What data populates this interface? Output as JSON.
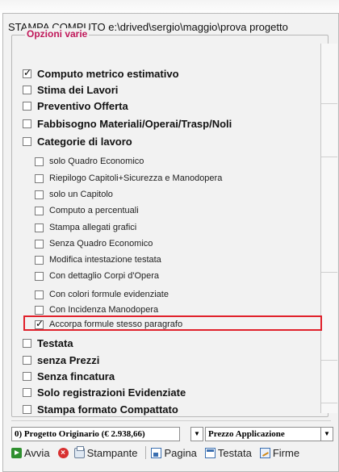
{
  "window": {
    "title": "STAMPA  COMPUTO  e:\\drived\\sergio\\maggio\\prova  progetto"
  },
  "options_group": {
    "legend": "Opzioni varie",
    "main_options": [
      {
        "label": "Computo metrico estimativo",
        "checked": true
      },
      {
        "label": "Stima dei Lavori",
        "checked": false
      },
      {
        "label": "Preventivo Offerta",
        "checked": false
      },
      {
        "label": "Fabbisogno Materiali/Operai/Trasp/Noli",
        "checked": false
      },
      {
        "label": "Categorie di lavoro",
        "checked": false
      }
    ],
    "sub_options": [
      {
        "label": "solo Quadro Economico",
        "checked": false
      },
      {
        "label": "Riepilogo Capitoli+Sicurezza e Manodopera",
        "checked": false
      },
      {
        "label": "solo un Capitolo",
        "checked": false
      },
      {
        "label": "Computo a percentuali",
        "checked": false
      },
      {
        "label": "Stampa allegati grafici",
        "checked": false
      },
      {
        "label": "Senza Quadro Economico",
        "checked": false
      },
      {
        "label": "Modifica intestazione testata",
        "checked": false
      },
      {
        "label": "Con dettaglio Corpi d'Opera",
        "checked": false
      },
      {
        "label": "Con colori formule evidenziate",
        "checked": false
      },
      {
        "label": "Con Incidenza Manodopera",
        "checked": false
      },
      {
        "label": "Accorpa formule stesso paragrafo",
        "checked": true
      }
    ],
    "bottom_options": [
      {
        "label": "Testata",
        "checked": false
      },
      {
        "label": "senza Prezzi",
        "checked": false
      },
      {
        "label": "Senza fincatura",
        "checked": false
      },
      {
        "label": "Solo registrazioni Evidenziate",
        "checked": false
      },
      {
        "label": "Stampa formato Compattato",
        "checked": false
      }
    ]
  },
  "selectors": {
    "project": "0) Progetto Originario (€ 2.938,66)",
    "price": "Prezzo Applicazione"
  },
  "toolbar": {
    "avvia": "Avvia",
    "stampante": "Stampante",
    "pagina": "Pagina",
    "testata": "Testata",
    "firme": "Firme"
  },
  "colors": {
    "legend": "#c0185a",
    "highlight_border": "#e0202a"
  }
}
